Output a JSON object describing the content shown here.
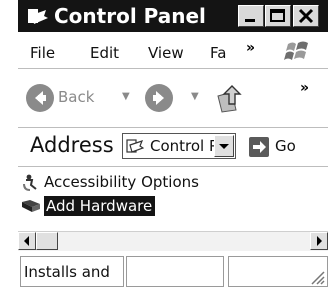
{
  "window": {
    "title": "Control Panel",
    "title_icon": "control-panel-icon",
    "caption_buttons": [
      "minimize-icon",
      "maximize-icon",
      "close-icon"
    ]
  },
  "menubar": {
    "items": [
      "File",
      "Edit",
      "View",
      "Fa"
    ],
    "overflow_chevron": "»",
    "logo_icon": "windows-flag-icon"
  },
  "toolbar": {
    "back_label": "Back",
    "back_dropdown": "▼",
    "forward_dropdown": "▼",
    "overflow_chevron": "»",
    "icons": [
      "back-arrow-icon",
      "forward-arrow-icon",
      "up-folder-icon"
    ]
  },
  "address": {
    "label": "Address",
    "value": "Control Panel",
    "go_label": "Go"
  },
  "content": {
    "items": [
      {
        "label": "Accessibility Options",
        "icon": "accessibility-icon",
        "selected": false
      },
      {
        "label": "Add Hardware",
        "icon": "add-hardware-icon",
        "selected": true
      }
    ]
  },
  "statusbar": {
    "text": "Installs and"
  },
  "colors": {
    "titlebar": "#141414",
    "selection": "#141414",
    "disabled": "#8a8a8a"
  }
}
